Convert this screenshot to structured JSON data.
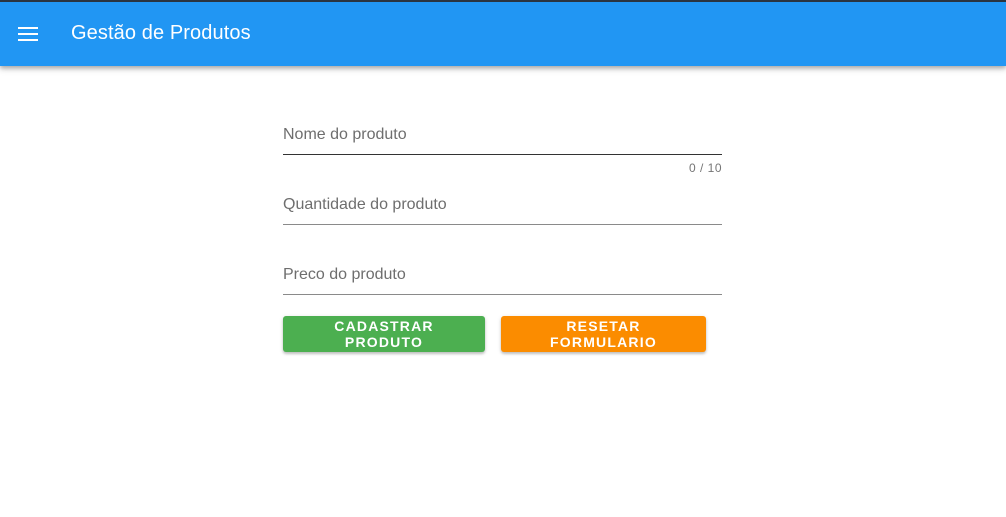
{
  "app": {
    "title": "Gestão de Produtos",
    "menu_icon": "hamburger-menu-icon",
    "accent_color": "#2196f3"
  },
  "form": {
    "fields": [
      {
        "placeholder": "Nome do produto",
        "value": "",
        "counter": "0 / 10"
      },
      {
        "placeholder": "Quantidade do produto",
        "value": ""
      },
      {
        "placeholder": "Preco do produto",
        "value": ""
      }
    ],
    "buttons": {
      "submit_label": "CADASTRAR PRODUTO",
      "submit_color": "#4caf50",
      "reset_label": "RESETAR FORMULARIO",
      "reset_color": "#fb8c00"
    }
  }
}
